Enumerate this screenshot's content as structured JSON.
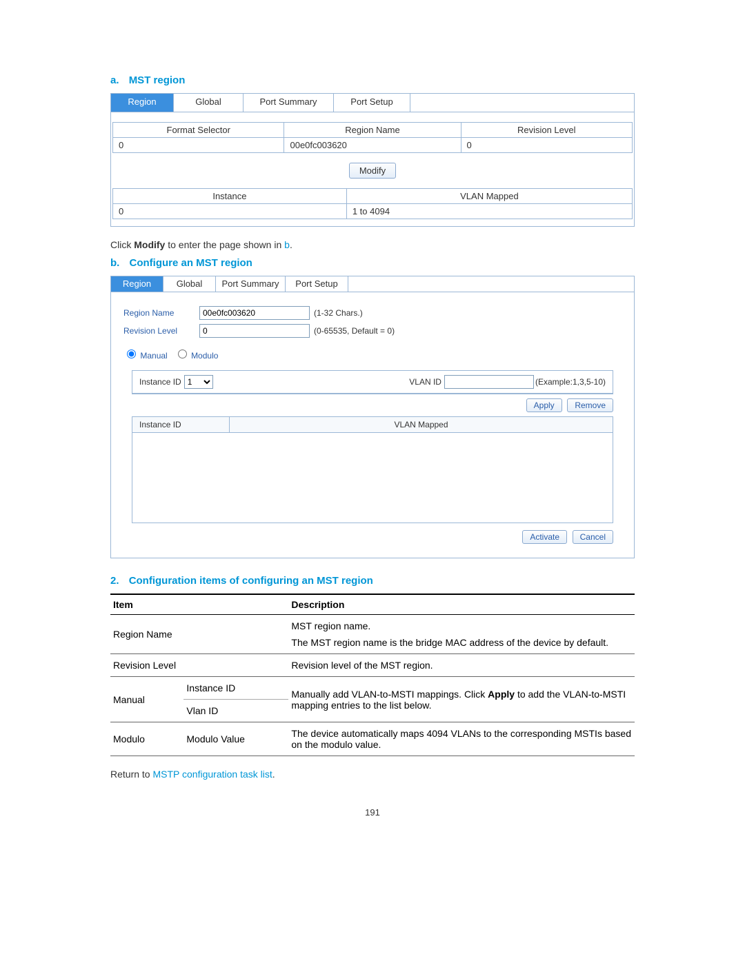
{
  "sectionA": {
    "letter": "a.",
    "title": "MST region",
    "tabs": [
      "Region",
      "Global",
      "Port Summary",
      "Port Setup"
    ],
    "tab_widths": [
      "90px",
      "100px",
      "130px",
      "110px"
    ],
    "table1_headers": [
      "Format Selector",
      "Region Name",
      "Revision Level"
    ],
    "table1_values": [
      "0",
      "00e0fc003620",
      "0"
    ],
    "modify_btn": "Modify",
    "table2_headers": [
      "Instance",
      "VLAN Mapped"
    ],
    "table2_values": [
      "0",
      "1 to 4094"
    ]
  },
  "modifyText": {
    "pre": "Click ",
    "bold": "Modify",
    "post": " to enter the page shown in ",
    "link": "b",
    "end": "."
  },
  "sectionB": {
    "letter": "b.",
    "title": "Configure an MST region",
    "tabs": [
      "Region",
      "Global",
      "Port Summary",
      "Port Setup"
    ],
    "tab_widths": [
      "75px",
      "75px",
      "100px",
      "90px"
    ],
    "regionName_label": "Region Name",
    "regionName_value": "00e0fc003620",
    "regionName_hint": "(1-32 Chars.)",
    "revisionLevel_label": "Revision Level",
    "revisionLevel_value": "0",
    "revisionLevel_hint": "(0-65535, Default = 0)",
    "radio_manual": "Manual",
    "radio_modulo": "Modulo",
    "instanceId_label": "Instance ID",
    "instanceId_value": "1",
    "vlanId_label": "VLAN ID",
    "vlanId_hint": "(Example:1,3,5-10)",
    "apply_btn": "Apply",
    "remove_btn": "Remove",
    "grid_headers": [
      "Instance ID",
      "VLAN Mapped"
    ],
    "activate_btn": "Activate",
    "cancel_btn": "Cancel"
  },
  "section2": {
    "letter": "2.",
    "title": "Configuration items of configuring an MST region",
    "col_item": "Item",
    "col_desc": "Description",
    "rows": {
      "regionName_item": "Region Name",
      "regionName_desc1": "MST region name.",
      "regionName_desc2": "The MST region name is the bridge MAC address of the device by default.",
      "revisionLevel_item": "Revision Level",
      "revisionLevel_desc": "Revision level of the MST region.",
      "manual_item": "Manual",
      "manual_sub1": "Instance ID",
      "manual_sub2": "Vlan ID",
      "manual_desc": "Manually add VLAN-to-MSTI mappings. Click Apply to add the VLAN-to-MSTI mapping entries to the list below.",
      "modulo_item": "Modulo",
      "modulo_sub": "Modulo Value",
      "modulo_desc": "The device automatically maps 4094 VLANs to the corresponding MSTIs based on the modulo value."
    }
  },
  "returnText": {
    "pre": "Return to ",
    "link": "MSTP configuration task list",
    "end": "."
  },
  "pageNumber": "191"
}
